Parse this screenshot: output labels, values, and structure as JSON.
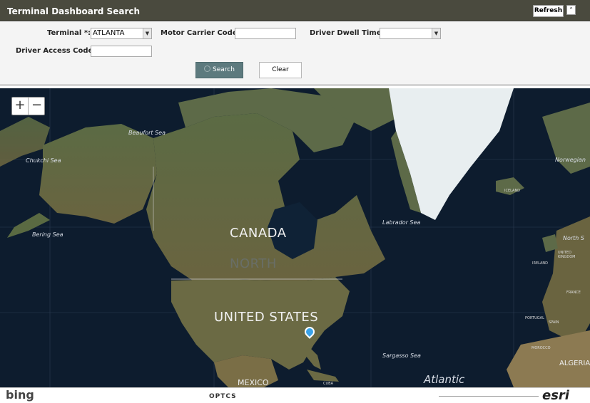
{
  "header": {
    "title": "Terminal Dashboard Search",
    "refresh_label": "Refresh",
    "collapse_glyph": "⌃"
  },
  "form": {
    "terminal_label": "Terminal *:",
    "terminal_value": "ATLANTA",
    "motor_carrier_label": "Motor Carrier Code:",
    "motor_carrier_value": "",
    "dwell_label": "Driver Dwell Time:",
    "dwell_value": "",
    "access_label": "Driver Access Code:",
    "access_value": "",
    "search_label": "Search",
    "clear_label": "Clear"
  },
  "map": {
    "zoom_in": "+",
    "zoom_out": "−",
    "labels": {
      "beaufort": "Beaufort Sea",
      "chukchi": "Chukchi Sea",
      "bering": "Bering Sea",
      "labrador": "Labrador Sea",
      "norwegian": "Norwegian",
      "north_sea": "North S",
      "canada": "CANADA",
      "north": "NORTH",
      "usa": "UNITED STATES",
      "sargasso": "Sargasso Sea",
      "atlantic": "Atlantic",
      "mexico": "MEXICO",
      "iceland": "ICELAND",
      "ireland": "IRELAND",
      "united_kingdom": "UNITED KINGDOM",
      "france": "FRANCE",
      "portugal": "PORTUGAL",
      "spain": "SPAIN",
      "morocco": "MOROCCO",
      "algeria": "ALGERIA",
      "cuba": "CUBA"
    },
    "colors": {
      "ocean": "#0d1c2e",
      "land": "#4a5a35",
      "ice": "#e8eef0",
      "pin": "#3aa2e8"
    }
  },
  "footer": {
    "bing": "bing",
    "optics": "OPTCS",
    "esri": "esri"
  }
}
